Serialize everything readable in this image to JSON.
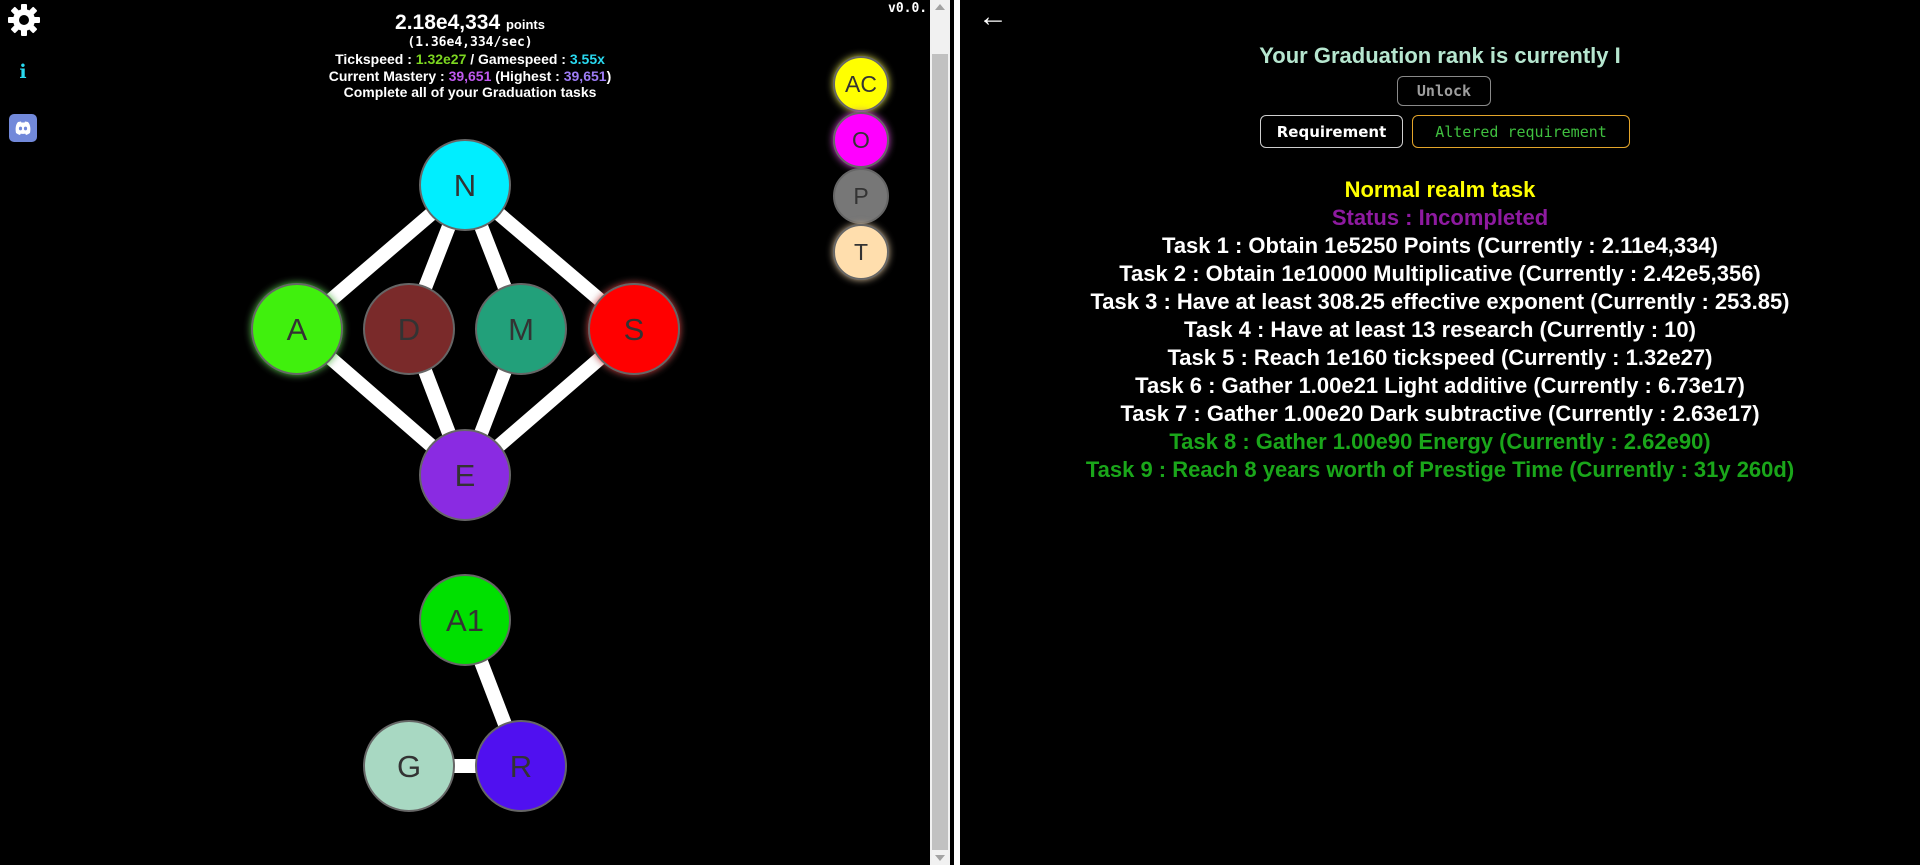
{
  "version": "v0.0.",
  "stats": {
    "points_value": "2.18e4,334",
    "points_unit": "points",
    "points_rate": "(1.36e4,334/sec)",
    "tickspeed_label": "Tickspeed :",
    "tickspeed_value": "1.32e27",
    "gamespeed_label": "/ Gamespeed :",
    "gamespeed_value": "3.55x",
    "mastery_label": "Current Mastery :",
    "mastery_value": "39,651",
    "highest_label": "(Highest :",
    "highest_value": "39,651",
    "highest_close": ")",
    "goal_text": "Complete all of your Graduation tasks"
  },
  "sidebar": {
    "settings_icon": "gear-icon",
    "info_label": "i",
    "discord_icon": "discord-icon"
  },
  "tree": {
    "nodes": [
      {
        "key": "n",
        "label": "N",
        "color": "#00eeff"
      },
      {
        "key": "a",
        "label": "A",
        "color": "#3ff00a"
      },
      {
        "key": "d",
        "label": "D",
        "color": "#7a2a2a"
      },
      {
        "key": "m",
        "label": "M",
        "color": "#22a07a"
      },
      {
        "key": "s",
        "label": "S",
        "color": "#ff0000"
      },
      {
        "key": "e",
        "label": "E",
        "color": "#8a2be2"
      },
      {
        "key": "a1",
        "label": "A1",
        "color": "#00e000"
      },
      {
        "key": "g",
        "label": "G",
        "color": "#a8d8c2"
      },
      {
        "key": "r",
        "label": "R",
        "color": "#5010f0"
      }
    ],
    "side_nodes": [
      {
        "key": "ac",
        "label": "AC",
        "color": "#ffff00"
      },
      {
        "key": "o",
        "label": "O",
        "color": "#ff00ff"
      },
      {
        "key": "p",
        "label": "P",
        "color": "#777777"
      },
      {
        "key": "t",
        "label": "T",
        "color": "#ffdead"
      }
    ]
  },
  "graduation": {
    "back_icon": "left-arrow-icon",
    "back_label": "←",
    "rank_title": "Your Graduation rank is currently I",
    "unlock_label": "Unlock",
    "requirement_label": "Requirement",
    "altered_requirement_label": "Altered requirement",
    "task_heading": "Normal realm task",
    "status": "Status : Incompleted",
    "tasks": [
      {
        "text": "Task 1 : Obtain 1e5250 Points (Currently : 2.11e4,334)",
        "done": false
      },
      {
        "text": "Task 2 : Obtain 1e10000 Multiplicative (Currently : 2.42e5,356)",
        "done": false
      },
      {
        "text": "Task 3 : Have at least 308.25 effective exponent (Currently : 253.85)",
        "done": false
      },
      {
        "text": "Task 4 : Have at least 13 research (Currently : 10)",
        "done": false
      },
      {
        "text": "Task 5 : Reach 1e160 tickspeed (Currently : 1.32e27)",
        "done": false
      },
      {
        "text": "Task 6 : Gather 1.00e21 Light additive (Currently : 6.73e17)",
        "done": false
      },
      {
        "text": "Task 7 : Gather 1.00e20 Dark subtractive (Currently : 2.63e17)",
        "done": false
      },
      {
        "text": "Task 8 : Gather 1.00e90 Energy (Currently : 2.62e90)",
        "done": true
      },
      {
        "text": "Task 9 : Reach 8 years worth of Prestige Time (Currently : 31y 260d)",
        "done": true
      }
    ]
  }
}
